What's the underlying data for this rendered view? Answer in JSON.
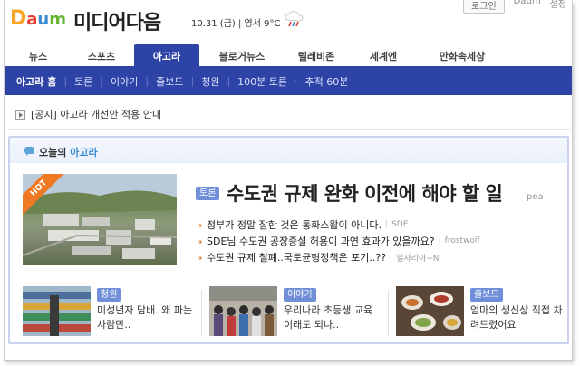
{
  "header": {
    "logo": {
      "d": "D",
      "a": "a",
      "u": "u",
      "m": "m"
    },
    "site_title": "미디어다음",
    "date": "10.31 (금) | 영서 9°C",
    "weather_icon": "rain-cloud-icon",
    "top_links": [
      "로그인",
      "Daum",
      "설정"
    ]
  },
  "tabs": [
    {
      "label": "뉴스",
      "active": false
    },
    {
      "label": "스포츠",
      "active": false
    },
    {
      "label": "아고라",
      "active": true
    },
    {
      "label": "블로거뉴스",
      "active": false
    },
    {
      "label": "텔레비존",
      "active": false
    },
    {
      "label": "세계엔",
      "active": false
    },
    {
      "label": "만화속세상",
      "active": false
    }
  ],
  "subnav": {
    "current": "아고라 홈",
    "items": [
      "토론",
      "이야기",
      "즐보드",
      "청원",
      "100분 토론",
      "추적 60분"
    ]
  },
  "notice": {
    "text": "[공지] 아고라 개선안 적용 안내",
    "icon": "notice-arrow-icon"
  },
  "today": {
    "title_prefix": "오늘의",
    "title_highlight": "아고라",
    "chat_icon": "chat-bubble-icon",
    "hot_label": "HOT",
    "headline": {
      "tag": "토론",
      "title": "수도권 규제 완화 이전에 해야 할 일",
      "author": "pea"
    },
    "subitems": [
      {
        "text": "정부가 정말 잘한 것은 통화스왑이 아니다.",
        "author": "SDE"
      },
      {
        "text": "SDE님 수도권 공장증설 허용이 과연 효과가 있을까요?",
        "author": "frostwolf"
      },
      {
        "text": "수도권 규제 철폐..국토균형정책은 포기..??",
        "author": "옐사리아~N"
      }
    ],
    "cards": [
      {
        "tag": "청원",
        "text": "미성년자 담배. 왜 파는 사람만.."
      },
      {
        "tag": "이야기",
        "text": "우리나라 초등생 교육 이래도 되나.."
      },
      {
        "tag": "즐보드",
        "text": "엄마의 생신상 직접 차려드렸어요"
      }
    ]
  },
  "colors": {
    "accent": "#2e43a6",
    "tag": "#6f8fd9",
    "hot": "#f07a23",
    "arrow": "#e07a2a"
  }
}
